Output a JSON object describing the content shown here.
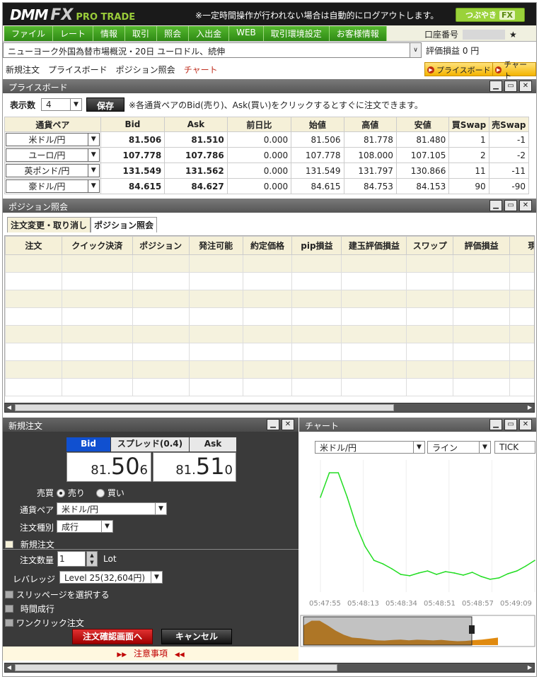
{
  "header": {
    "logo_dmm": "DMM",
    "logo_fx": "FX",
    "logo_pro": "PRO TRADE",
    "notice": "※一定時間操作が行われない場合は自動的にログアウトします。",
    "tweet_label": "つぶやき",
    "tweet_fx": "FX"
  },
  "menu": [
    "ファイル",
    "レート",
    "情報",
    "取引",
    "照会",
    "入出金",
    "WEB",
    "取引環境設定",
    "お客様情報"
  ],
  "account": {
    "label": "口座番号",
    "star": "★"
  },
  "news": {
    "headline": "ニューヨーク外国為替市場概況・20日 ユーロドル、続伸",
    "pnl_label": "評価損益",
    "pnl_value": "0 円"
  },
  "nav": {
    "items": [
      "新規注文",
      "プライスボード",
      "ポジション照会",
      "チャート"
    ],
    "active": "チャート",
    "quick1": "プライスボード",
    "quick2": "チャート"
  },
  "priceboard": {
    "title": "プライスボード",
    "display_count_label": "表示数",
    "display_count": "4",
    "save_label": "保存",
    "hint": "※各通貨ペアのBid(売り)、Ask(買い)をクリックするとすぐに注文できます。",
    "columns": [
      "通貨ペア",
      "Bid",
      "Ask",
      "前日比",
      "始値",
      "高値",
      "安値",
      "買Swap",
      "売Swap"
    ],
    "rows": [
      [
        "米ドル/円",
        "81.506",
        "81.510",
        "0.000",
        "81.506",
        "81.778",
        "81.480",
        "1",
        "-1"
      ],
      [
        "ユーロ/円",
        "107.778",
        "107.786",
        "0.000",
        "107.778",
        "108.000",
        "107.105",
        "2",
        "-2"
      ],
      [
        "英ポンド/円",
        "131.549",
        "131.562",
        "0.000",
        "131.549",
        "131.797",
        "130.866",
        "11",
        "-11"
      ],
      [
        "豪ドル/円",
        "84.615",
        "84.627",
        "0.000",
        "84.615",
        "84.753",
        "84.153",
        "90",
        "-90"
      ]
    ]
  },
  "positions": {
    "title": "ポジション照会",
    "tabs": [
      "注文変更・取り消し",
      "ポジション照会"
    ],
    "columns": [
      "注文",
      "クイック決済",
      "ポジション",
      "発注可能",
      "約定価格",
      "pip損益",
      "建玉評価損益",
      "スワップ",
      "評価損益",
      "現在"
    ]
  },
  "order": {
    "title": "新規注文",
    "bid_label": "Bid",
    "spread_label": "スプレッド(0.4)",
    "ask_label": "Ask",
    "bid_small": "81.",
    "bid_big": "50",
    "bid_tail": "6",
    "ask_small": "81.",
    "ask_big": "51",
    "ask_tail": "0",
    "side_label": "売買",
    "sell_label": "売り",
    "buy_label": "買い",
    "pair_label": "通貨ペア",
    "pair_value": "米ドル/円",
    "type_label": "注文種別",
    "type_value": "成行",
    "section_label": "新規注文",
    "qty_label": "注文数量",
    "qty_value": "1",
    "qty_unit": "Lot",
    "lev_label": "レバレッジ",
    "lev_value": "Level 25(32,604円)",
    "slip_label": "スリッページを選択する",
    "time_label": "時間成行",
    "oneclick_label": "ワンクリック注文",
    "confirm_label": "注文確認画面へ",
    "cancel_label": "キャンセル",
    "caution": "注意事項"
  },
  "chart": {
    "title": "チャート",
    "pair": "米ドル/円",
    "style": "ライン",
    "interval": "TICK",
    "line_color": "#22dd22",
    "mini_color": "#e08a10"
  },
  "chart_data": {
    "type": "line",
    "x": [
      "05:47:55",
      "05:48:13",
      "05:48:34",
      "05:48:51",
      "05:48:57",
      "05:49:09"
    ],
    "series": [
      {
        "values": [
          81.51,
          81.545,
          81.545,
          81.51,
          81.47,
          81.44,
          81.42,
          81.415,
          81.408,
          81.4,
          81.398,
          81.402,
          81.405,
          81.4,
          81.404,
          81.402,
          81.399,
          81.403,
          81.397,
          81.393,
          81.395,
          81.401,
          81.405,
          81.412,
          81.42
        ]
      }
    ]
  }
}
